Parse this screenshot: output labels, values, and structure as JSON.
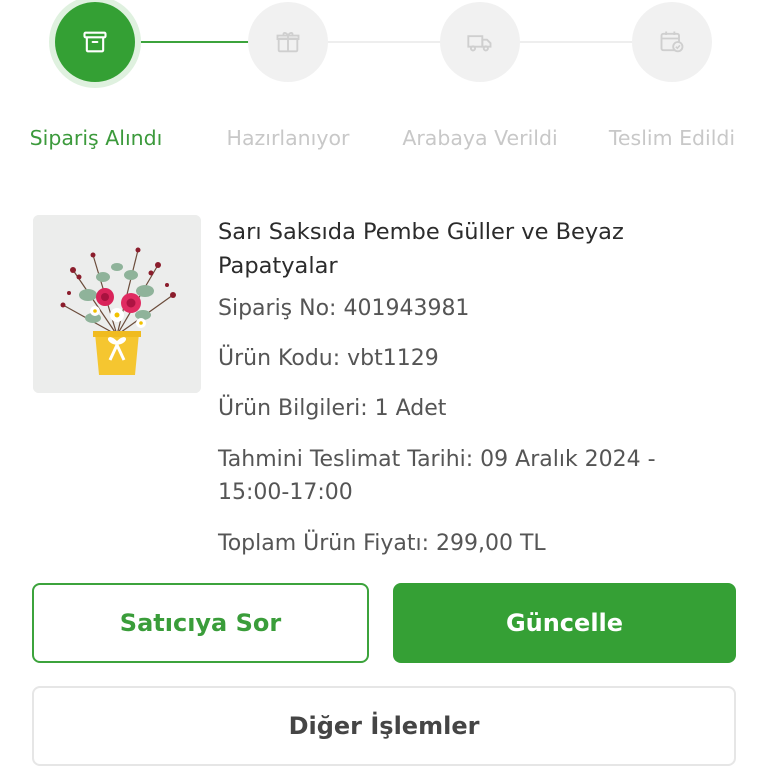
{
  "stepper": {
    "steps": [
      {
        "label": "Sipariş Alındı",
        "icon": "box-icon",
        "state": "active"
      },
      {
        "label": "Hazırlanıyor",
        "icon": "gift-icon",
        "state": "pending"
      },
      {
        "label": "Arabaya Verildi",
        "icon": "truck-icon",
        "state": "pending"
      },
      {
        "label": "Teslim Edildi",
        "icon": "calendar-check-icon",
        "state": "pending"
      }
    ],
    "colors": {
      "active": "#34a034",
      "active_text": "#3c9a3c",
      "inactive": "#f1f1f1",
      "inactive_text": "#c8c8c8"
    }
  },
  "product": {
    "image": "flower-pot-photo",
    "title": "Sarı Saksıda Pembe Güller ve Beyaz Papatyalar",
    "order_no": "Sipariş No: 401943981",
    "product_code": "Ürün Kodu: vbt1129",
    "product_info": "Ürün Bilgileri: 1 Adet",
    "delivery": "Tahmini Teslimat Tarihi: 09 Aralık 2024 - 15:00-17:00",
    "total": "Toplam Ürün Fiyatı: 299,00 TL"
  },
  "actions": {
    "ask_seller": "Satıcıya Sor",
    "update": "Güncelle",
    "other": "Diğer İşlemler",
    "accent": "#35a035"
  }
}
